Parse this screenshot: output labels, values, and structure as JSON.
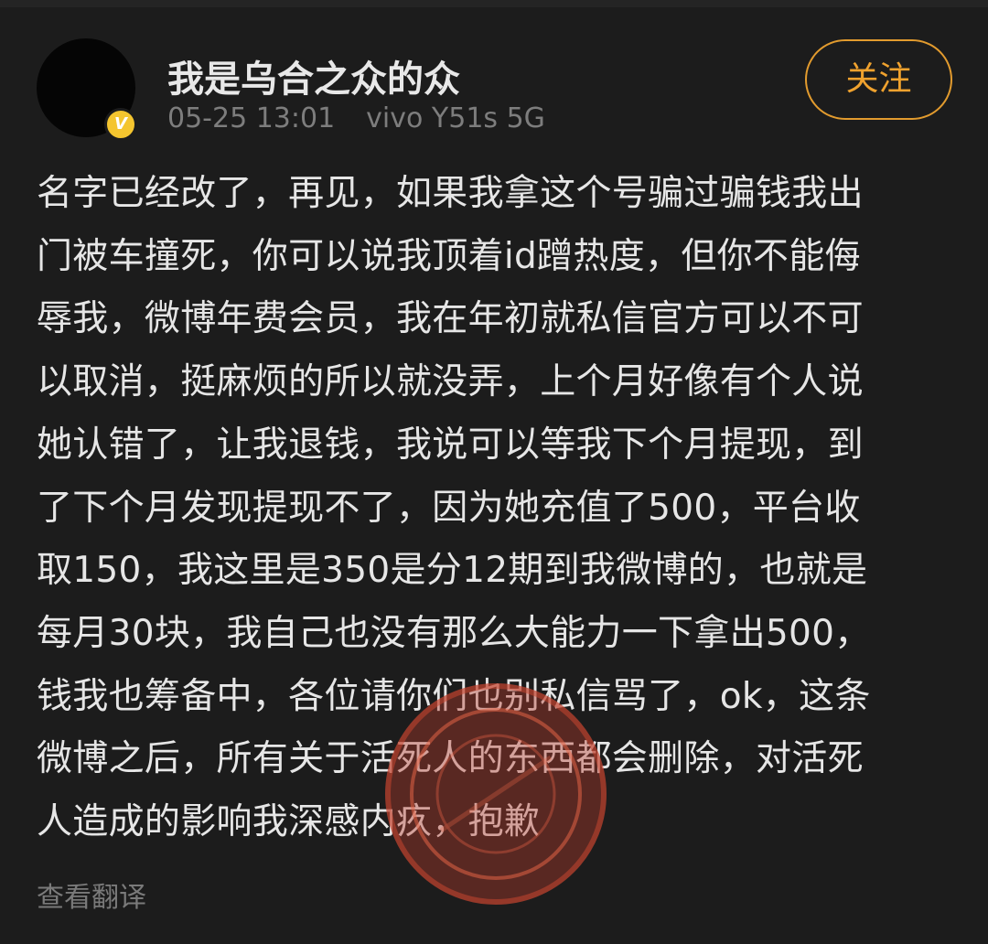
{
  "user": {
    "name": "我是乌合之众的众",
    "verified_badge": "V",
    "time": "05-25 13:01",
    "device": "vivo Y51s 5G"
  },
  "follow_button": {
    "label": "关注"
  },
  "post": {
    "lines": [
      "名字已经改了，再见，如果我拿这个号骗过骗钱我出",
      "门被车撞死，你可以说我顶着id蹭热度，但你不能侮",
      "辱我，微博年费会员，我在年初就私信官方可以不可",
      "以取消，挺麻烦的所以就没弄，上个月好像有个人说",
      "她认错了，让我退钱，我说可以等我下个月提现，到",
      "了下个月发现提现不了，因为她充值了500，平台收",
      "取150，我这里是350是分12期到我微博的，也就是",
      "每月30块，我自己也没有那么大能力一下拿出500，",
      "钱我也筹备中，各位请你们也别私信骂了，ok，这条",
      "微博之后，所有关于活死人的东西都会删除，对活死",
      "人造成的影响我深感内疚，抱歉"
    ]
  },
  "translate_link": {
    "label": "查看翻译"
  },
  "colors": {
    "background": "#1c1c1c",
    "accent": "#f0a22e",
    "verified": "#f4c52f",
    "watermark": "#b83a2c"
  },
  "icons": {
    "verified": "verified-v-icon",
    "watermark": "watermark-stamp"
  }
}
